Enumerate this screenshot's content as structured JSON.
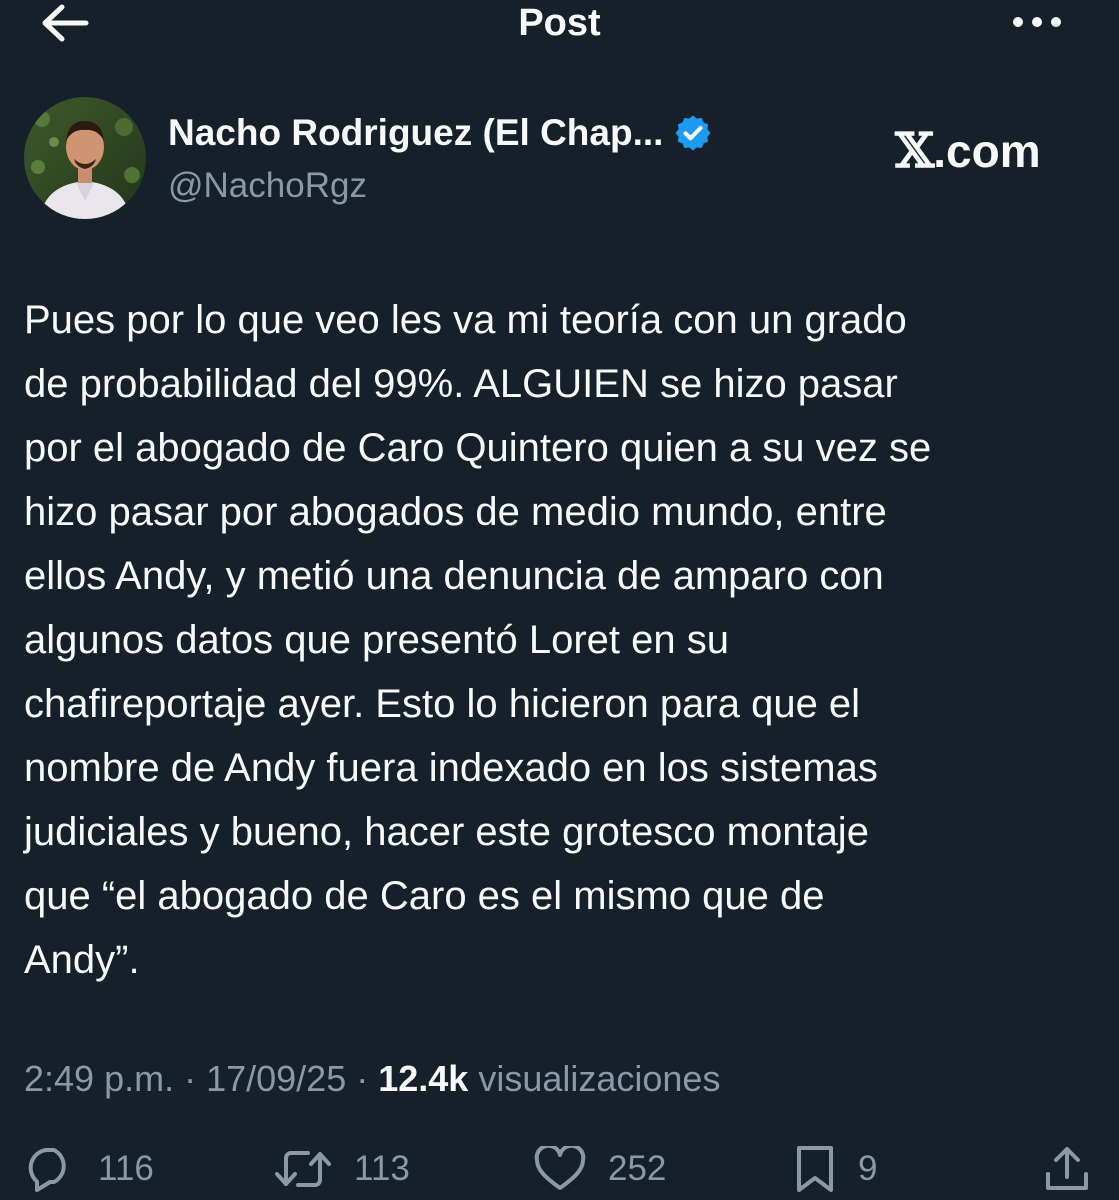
{
  "header": {
    "title": "Post",
    "back_icon": "arrow-left-icon",
    "more_icon": "more-horizontal-icon"
  },
  "author": {
    "display_name": "Nacho Rodriguez (El Chap...",
    "handle": "@NachoRgz",
    "verified": true,
    "verified_color": "#1d9bf0"
  },
  "watermark": {
    "mark": "𝕏",
    "text": ".com"
  },
  "post": {
    "lines": [
      "Pues por lo que veo les va mi teoría con un grado",
      "de probabilidad del 99%. ALGUIEN se hizo pasar",
      "por el abogado de Caro Quintero quien a su vez se",
      "hizo pasar por abogados de medio mundo, entre",
      "ellos Andy, y metió una denuncia de amparo con",
      "algunos datos que presentó Loret en su",
      "chafireportaje ayer. Esto lo hicieron para que el",
      "nombre de Andy fuera indexado en los sistemas",
      "judiciales y bueno, hacer este grotesco montaje",
      "que “el abogado de Caro es el mismo que de",
      "Andy”."
    ]
  },
  "meta": {
    "time": "2:49 p.m.",
    "sep1": " · ",
    "date": "17/09/25",
    "sep2": " · ",
    "views": "12.4k",
    "views_label": " visualizaciones"
  },
  "actions": {
    "replies": "116",
    "reposts": "113",
    "likes": "252",
    "bookmarks": "9"
  },
  "colors": {
    "background": "#15202b",
    "text": "#f7f9f9",
    "muted": "#8b98a5",
    "accent": "#1d9bf0"
  }
}
